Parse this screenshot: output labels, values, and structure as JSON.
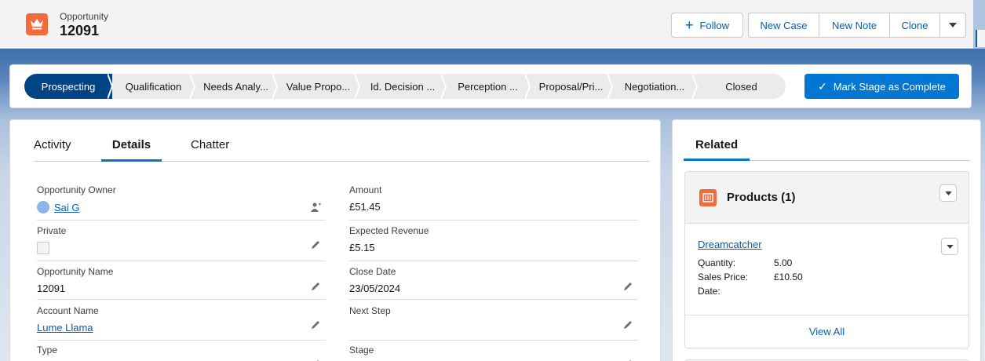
{
  "header": {
    "object_type": "Opportunity",
    "record_name": "12091",
    "buttons": {
      "follow": "Follow",
      "new_case": "New Case",
      "new_note": "New Note",
      "clone": "Clone"
    }
  },
  "path": {
    "stages": [
      "Prospecting",
      "Qualification",
      "Needs Analy...",
      "Value Propo...",
      "Id. Decision ...",
      "Perception ...",
      "Proposal/Pri...",
      "Negotiation...",
      "Closed"
    ],
    "current_index": 0,
    "mark_button": "Mark Stage as Complete"
  },
  "tabs": [
    "Activity",
    "Details",
    "Chatter"
  ],
  "active_tab": "Details",
  "fields": {
    "owner": {
      "label": "Opportunity Owner",
      "value": "Sai G"
    },
    "private": {
      "label": "Private",
      "value": false
    },
    "opp_name": {
      "label": "Opportunity Name",
      "value": "12091"
    },
    "account": {
      "label": "Account Name",
      "value": "Lume Llama"
    },
    "type": {
      "label": "Type",
      "value": ""
    },
    "amount": {
      "label": "Amount",
      "value": "£51.45"
    },
    "expected_revenue": {
      "label": "Expected Revenue",
      "value": "£5.15"
    },
    "close_date": {
      "label": "Close Date",
      "value": "23/05/2024"
    },
    "next_step": {
      "label": "Next Step",
      "value": ""
    },
    "stage": {
      "label": "Stage",
      "value": ""
    }
  },
  "related": {
    "tab": "Related",
    "products": {
      "title": "Products (1)",
      "item_name": "Dreamcatcher",
      "quantity_label": "Quantity:",
      "quantity": "5.00",
      "price_label": "Sales Price:",
      "price": "£10.50",
      "date_label": "Date:",
      "date": "",
      "view_all": "View All"
    }
  },
  "colors": {
    "brand": "#0176d3",
    "current_stage": "#014486",
    "object_icon": "#f26c3b"
  }
}
